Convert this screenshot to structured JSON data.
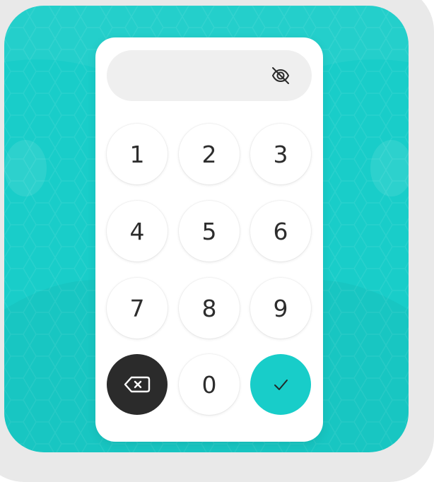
{
  "keypad": {
    "keys": [
      "1",
      "2",
      "3",
      "4",
      "5",
      "6",
      "7",
      "8",
      "9",
      "0"
    ],
    "backspace_icon": "backspace-icon",
    "confirm_icon": "check-icon",
    "visibility_icon": "eye-off-icon"
  },
  "colors": {
    "accent": "#19cdc9",
    "dark_key": "#2b2b2b",
    "field_bg": "#efefef",
    "background_frame": "#e9e9e9"
  }
}
